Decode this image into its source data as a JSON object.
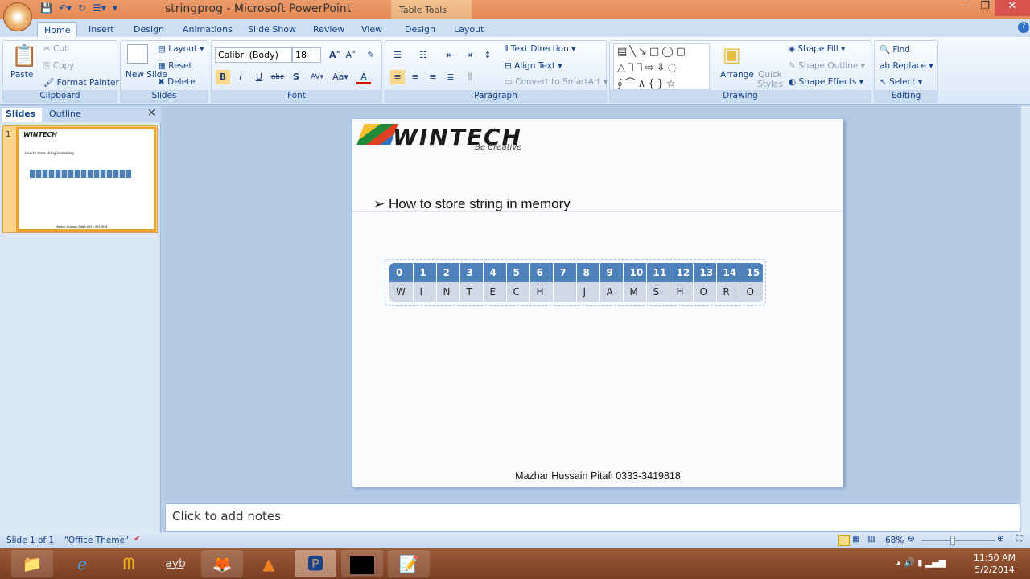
{
  "window": {
    "title": "stringprog - Microsoft PowerPoint",
    "context_tab": "Table Tools",
    "minimize": "–",
    "restore": "❐",
    "close": "✕"
  },
  "tabs": [
    "Home",
    "Insert",
    "Design",
    "Animations",
    "Slide Show",
    "Review",
    "View",
    "Design",
    "Layout"
  ],
  "ribbon": {
    "clipboard": {
      "label": "Clipboard",
      "paste": "Paste",
      "cut": "Cut",
      "copy": "Copy",
      "format_painter": "Format Painter"
    },
    "slides": {
      "label": "Slides",
      "new_slide": "New Slide",
      "layout": "Layout",
      "reset": "Reset",
      "delete": "Delete"
    },
    "font": {
      "label": "Font",
      "font_name": "Calibri (Body)",
      "font_size": "18"
    },
    "paragraph": {
      "label": "Paragraph",
      "text_direction": "Text Direction",
      "align_text": "Align Text",
      "convert_smartart": "Convert to SmartArt"
    },
    "drawing": {
      "label": "Drawing",
      "arrange": "Arrange",
      "quick_styles": "Quick Styles",
      "shape_fill": "Shape Fill",
      "shape_outline": "Shape Outline",
      "shape_effects": "Shape Effects"
    },
    "editing": {
      "label": "Editing",
      "find": "Find",
      "replace": "Replace",
      "select": "Select"
    }
  },
  "pane": {
    "tab_slides": "Slides",
    "tab_outline": "Outline",
    "slide_number": "1",
    "close": "×"
  },
  "slide": {
    "logo_text": "WINTECH",
    "logo_tagline": "Be Creative",
    "bullet": "How to store string in memory",
    "table": {
      "indices": [
        "0",
        "1",
        "2",
        "3",
        "4",
        "5",
        "6",
        "7",
        "8",
        "9",
        "10",
        "11",
        "12",
        "13",
        "14",
        "15"
      ],
      "chars": [
        "W",
        "I",
        "N",
        "T",
        "E",
        "C",
        "H",
        "",
        "J",
        "A",
        "M",
        "S",
        "H",
        "O",
        "R",
        "O"
      ]
    },
    "footer": "Mazhar Hussain Pitafi 0333-3419818"
  },
  "notes_placeholder": "Click to add notes",
  "status": {
    "slide": "Slide 1 of 1",
    "theme": "\"Office Theme\"",
    "zoom": "68%",
    "zoom_value": 68
  },
  "taskbar": {
    "time": "11:50 AM",
    "date": "5/2/2014"
  }
}
